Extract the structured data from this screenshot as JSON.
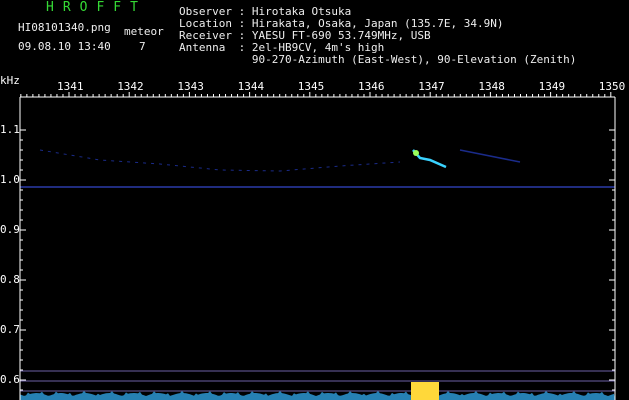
{
  "header": {
    "app_name": "HROFFT",
    "filename": "HI08101340.png",
    "datetime": "09.08.10 13:40",
    "meteor_label": "meteor",
    "meteor_count": "7",
    "observer": "Observer : Hirotaka Otsuka",
    "location": "Location : Hirakata, Osaka, Japan (135.7E, 34.9N)",
    "receiver": "Receiver : YAESU FT-690 53.749MHz, USB",
    "antenna": "Antenna  : 2el-HB9CV, 4m's high",
    "antenna2": "           90-270-Azimuth (East-West), 90-Elevation (Zenith)"
  },
  "axis": {
    "y_unit": "kHz",
    "x_ticks": [
      "1341",
      "1342",
      "1343",
      "1344",
      "1345",
      "1346",
      "1347",
      "1348",
      "1349",
      "1350"
    ],
    "y_ticks": [
      "1.1",
      "1.0",
      "0.9",
      "0.8",
      "0.7",
      "0.6"
    ]
  },
  "colors": {
    "bg": "#000000",
    "trace": "#1a2b8a",
    "meteor": "#3ad3ff",
    "carrier": "#2a3aa8"
  }
}
